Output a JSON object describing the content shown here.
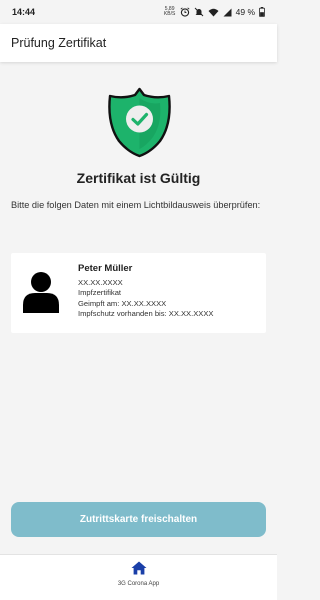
{
  "status_bar": {
    "time": "14:44",
    "net_rate_value": "5,89",
    "net_rate_unit": "KB/S",
    "battery": "49 %",
    "icons": [
      "alarm-icon",
      "mute-icon",
      "wifi-icon",
      "signal-icon",
      "battery-icon"
    ]
  },
  "app_bar": {
    "title": "Prüfung Zertifikat"
  },
  "result": {
    "title": "Zertifikat ist Gültig",
    "status_color": "#1db36b"
  },
  "instruction": "Bitte die folgen Daten mit einem Lichtbildausweis überprüfen:",
  "person": {
    "name": "Peter Müller",
    "birthdate": "XX.XX.XXXX",
    "certificate_type": "Impfzertifikat",
    "vaccinated_on": "Geimpft am: XX.XX.XXXX",
    "protection_until": "Impfschutz vorhanden bis: XX.XX.XXXX"
  },
  "unlock_button": {
    "label": "Zutrittskarte freischalten",
    "color": "#7fbccb"
  },
  "bottom_nav": {
    "items": [
      {
        "label": "3G Corona App",
        "icon": "home-icon",
        "color": "#1a3fa8"
      }
    ]
  }
}
